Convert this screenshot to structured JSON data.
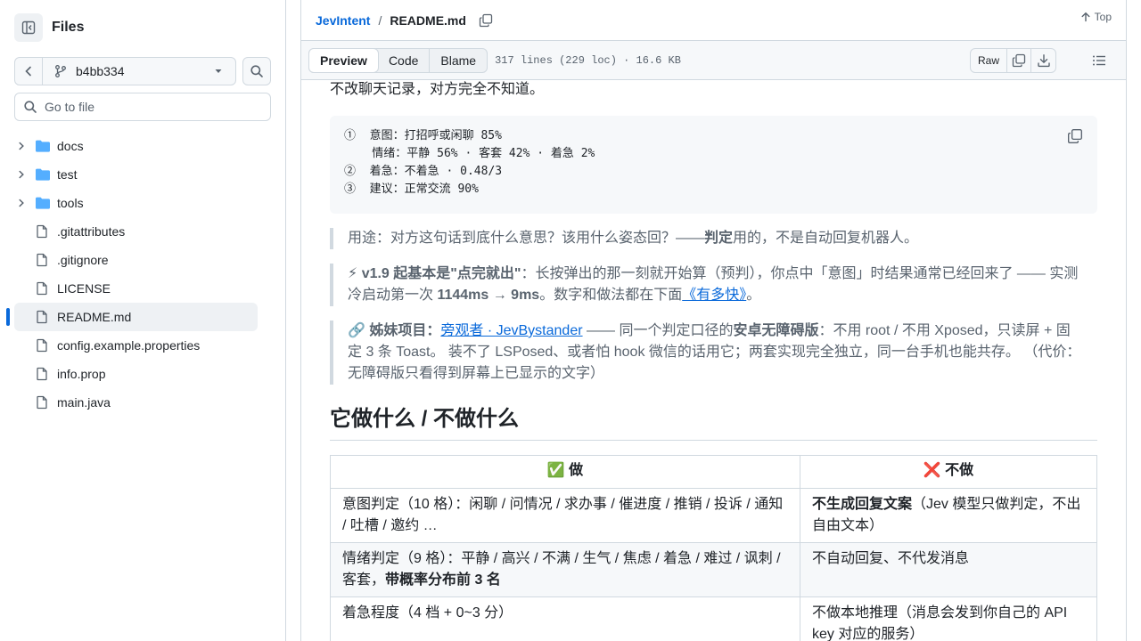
{
  "sidebar": {
    "title": "Files",
    "branch": "b4bb334",
    "search_placeholder": "Go to file",
    "tree": [
      {
        "type": "folder",
        "name": "docs"
      },
      {
        "type": "folder",
        "name": "test"
      },
      {
        "type": "folder",
        "name": "tools"
      },
      {
        "type": "file",
        "name": ".gitattributes"
      },
      {
        "type": "file",
        "name": ".gitignore"
      },
      {
        "type": "file",
        "name": "LICENSE"
      },
      {
        "type": "file",
        "name": "README.md",
        "selected": true
      },
      {
        "type": "file",
        "name": "config.example.properties"
      },
      {
        "type": "file",
        "name": "info.prop"
      },
      {
        "type": "file",
        "name": "main.java"
      }
    ]
  },
  "header": {
    "repo": "JevIntent",
    "separator": "/",
    "file": "README.md",
    "top_label": "Top"
  },
  "toolbar": {
    "tabs": [
      "Preview",
      "Code",
      "Blame"
    ],
    "active_tab": "Preview",
    "meta": "317 lines (229 loc) · 16.6 KB",
    "raw_label": "Raw"
  },
  "article": {
    "intro": "不改聊天记录，对方完全不知道。",
    "code_lines": [
      "①  意图：打招呼或闲聊 85%",
      "    情绪：平静 56% · 客套 42% · 着急 2%",
      "②  着急：不着急 · 0.48/3",
      "③  建议：正常交流 90%"
    ],
    "quote1": {
      "pre": "用途：对方这句话到底什么意思？该用什么姿态回？——",
      "bold": "判定",
      "post": "用的，不是自动回复机器人。"
    },
    "quote2": {
      "emoji": "⚡",
      "bold1": "v1.9 起基本是\"点完就出\"",
      "text1": "：长按弹出的那一刻就开始算（预判），你点中「意图」时结果通常已经回来了 —— 实测冷启动第一次 ",
      "bold2": "1144ms → 9ms",
      "text2": "。数字和做法都在下面",
      "link": "《有多快》",
      "text3": "。"
    },
    "quote3": {
      "emoji": "🔗",
      "bold1": "姊妹项目：",
      "link": "旁观者 · JevBystander",
      "text1": " —— 同一个判定口径的",
      "bold2": "安卓无障碍版",
      "text2": "：不用 root / 不用 Xposed，只读屏 + 固定 3 条 Toast。 装不了 LSPosed、或者怕 hook 微信的话用它；两套实现完全独立，同一台手机也能共存。 （代价：无障碍版只看得到屏幕上已显示的文字）"
    },
    "heading": "它做什么 / 不做什么",
    "table": {
      "col_do": "✅ 做",
      "col_dont": "❌ 不做",
      "rows": [
        {
          "do": "意图判定（10 格）：闲聊 / 问情况 / 求办事 / 催进度 / 推销 / 投诉 / 通知 / 吐槽 / 邀约 …",
          "dont_bold": "不生成回复文案",
          "dont": "（Jev 模型只做判定，不出自由文本）"
        },
        {
          "do": "情绪判定（9 格）：平静 / 高兴 / 不满 / 生气 / 焦虑 / 着急 / 难过 / 讽刺 / 客套，",
          "do_bold": "带概率分布前 3 名",
          "dont": "不自动回复、不代发消息"
        },
        {
          "do": "着急程度（4 档 + 0~3 分）",
          "dont": "不做本地推理（消息会发到你自己的 API key 对应的服务）"
        }
      ]
    }
  },
  "colors": {
    "accent": "#0969da",
    "border": "#d1d9e0",
    "muted": "#59636e",
    "folder": "#54aeff"
  }
}
